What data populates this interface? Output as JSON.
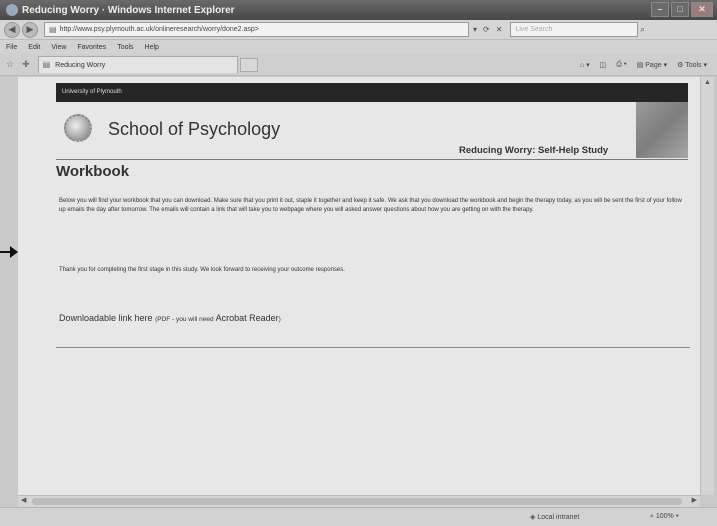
{
  "window": {
    "title": "Reducing Worry · Windows Internet Explorer"
  },
  "address_bar": {
    "url": "http://www.psy.plymouth.ac.uk/onlineresearch/worry/done2.asp>",
    "search_placeholder": "Live Search"
  },
  "menu": {
    "items": [
      "File",
      "Edit",
      "View",
      "Favorites",
      "Tools",
      "Help"
    ]
  },
  "tab": {
    "label": "Reducing Worry"
  },
  "command_bar": {
    "page_label": "Page",
    "tools_label": "Tools"
  },
  "page": {
    "banner": "University of Plymouth",
    "school_name": "School of Psychology",
    "study_title": "Reducing Worry: Self-Help Study",
    "heading": "Workbook",
    "paragraph": "Below you will find your workbook that you can download. Make sure that you print it out, staple it together and keep it safe. We ask that you download the workbook and begin the therapy today, as you will be sent the first of your follow up emails the day after tomorrow. The emails will contain a link that will take you to webpage where you will asked answer questions about how you are getting on with the therapy.",
    "thanks": "Thank you for completing the first stage in this study. We look forward to receiving your outcome responses.",
    "download_link": "Downloadable link here",
    "download_note_pre": "(PDF - you will need",
    "download_note_app": "Acrobat Reader",
    "download_note_post": ")"
  },
  "status_bar": {
    "zone": "Local intranet",
    "zoom": "100%"
  }
}
